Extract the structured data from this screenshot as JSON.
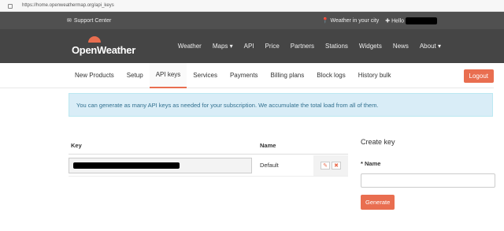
{
  "browser": {
    "url": "https://home.openweathermap.org/api_keys"
  },
  "topbar": {
    "support": "Support Center",
    "weather_city": "Weather in your city",
    "hello": "Hello"
  },
  "logo": {
    "text": "OpenWeather"
  },
  "nav": [
    {
      "label": "Weather"
    },
    {
      "label": "Maps ▾"
    },
    {
      "label": "API"
    },
    {
      "label": "Price"
    },
    {
      "label": "Partners"
    },
    {
      "label": "Stations"
    },
    {
      "label": "Widgets"
    },
    {
      "label": "News"
    },
    {
      "label": "About ▾"
    }
  ],
  "subnav": [
    {
      "label": "New Products"
    },
    {
      "label": "Setup"
    },
    {
      "label": "API keys"
    },
    {
      "label": "Services"
    },
    {
      "label": "Payments"
    },
    {
      "label": "Billing plans"
    },
    {
      "label": "Block logs"
    },
    {
      "label": "History bulk"
    }
  ],
  "logout": "Logout",
  "info": "You can generate as many API keys as needed for your subscription. We accumulate the total load from all of them.",
  "table": {
    "col_key": "Key",
    "col_name": "Name",
    "row_name": "Default"
  },
  "create": {
    "title": "Create key",
    "name_label": "* Name",
    "name_value": "",
    "button": "Generate"
  },
  "colors": {
    "accent": "#e96e50",
    "nav_bg": "#454545",
    "info_bg": "#d9edf7"
  }
}
